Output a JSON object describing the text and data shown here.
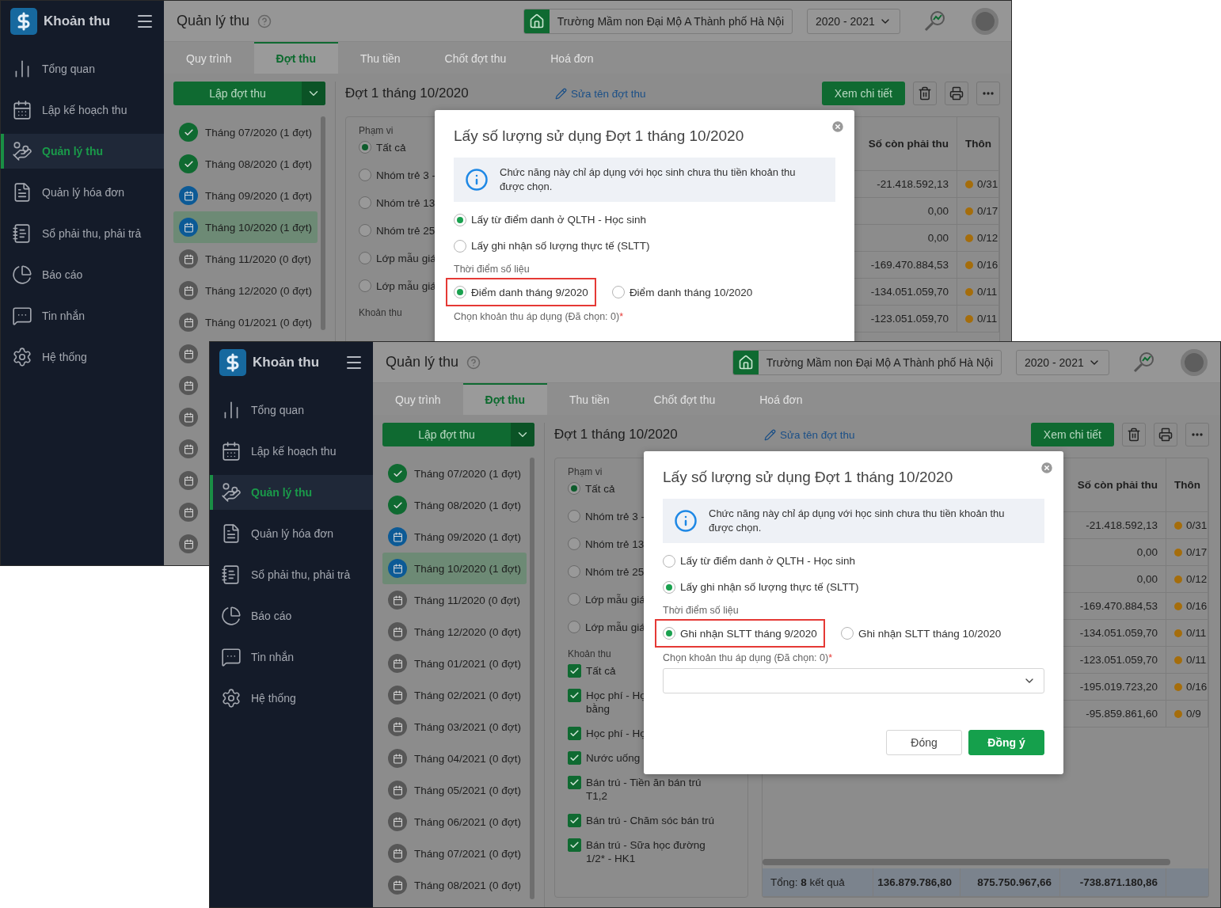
{
  "shots": [
    {
      "sidebar": {
        "title": "Khoản thu",
        "items": [
          {
            "label": "Tổng quan",
            "selected": false
          },
          {
            "label": "Lập kế hoạch thu",
            "selected": false
          },
          {
            "label": "Quản lý thu",
            "selected": true
          },
          {
            "label": "Quản lý hóa đơn",
            "selected": false
          },
          {
            "label": "Sổ phải thu, phải trả",
            "selected": false
          },
          {
            "label": "Báo cáo",
            "selected": false
          },
          {
            "label": "Tin nhắn",
            "selected": false
          },
          {
            "label": "Hệ thống",
            "selected": false
          }
        ]
      },
      "header": {
        "title": "Quản lý thu",
        "school": "Trường Mầm non Đại Mộ A Thành phố Hà Nội",
        "year": "2020 - 2021"
      },
      "tabs": [
        {
          "label": "Quy trình",
          "selected": false
        },
        {
          "label": "Đợt thu",
          "selected": true
        },
        {
          "label": "Thu tiền",
          "selected": false
        },
        {
          "label": "Chốt đợt thu",
          "selected": false
        },
        {
          "label": "Hoá đơn",
          "selected": false
        }
      ],
      "periods": {
        "button": "Lập đợt thu",
        "items": [
          {
            "label": "Tháng 07/2020 (1 đợt)",
            "kind": "done",
            "selected": false
          },
          {
            "label": "Tháng 08/2020 (1 đợt)",
            "kind": "done",
            "selected": false
          },
          {
            "label": "Tháng 09/2020 (1 đợt)",
            "kind": "current",
            "selected": false
          },
          {
            "label": "Tháng 10/2020 (1 đợt)",
            "kind": "current",
            "selected": true
          },
          {
            "label": "Tháng 11/2020 (0 đợt)",
            "kind": "pending",
            "selected": false
          },
          {
            "label": "Tháng 12/2020 (0 đợt)",
            "kind": "pending",
            "selected": false
          },
          {
            "label": "Tháng 01/2021 (0 đợt)",
            "kind": "pending",
            "selected": false
          },
          {
            "kind": "pending",
            "selected": false
          },
          {
            "kind": "pending",
            "selected": false
          },
          {
            "kind": "pending",
            "selected": false
          },
          {
            "kind": "pending",
            "selected": false
          },
          {
            "kind": "pending",
            "selected": false
          },
          {
            "kind": "pending",
            "selected": false
          },
          {
            "kind": "pending",
            "selected": false
          }
        ]
      },
      "batch": {
        "title": "Đợt 1 tháng 10/2020",
        "rename_link": "Sửa tên đợt thu",
        "detail_button": "Xem chi tiết"
      },
      "filters": {
        "scope_label": "Phạm vi",
        "scope": [
          {
            "label": "Tất cả",
            "selected": true
          },
          {
            "label": "Nhóm trẻ 3 -",
            "selected": false
          },
          {
            "label": "Nhóm trẻ 13",
            "selected": false
          },
          {
            "label": "Nhóm trẻ 25",
            "selected": false
          },
          {
            "label": "Lớp mẫu giá",
            "selected": false
          },
          {
            "label": "Lớp mẫu giá",
            "selected": false
          }
        ],
        "fee_label": "Khoản thu"
      },
      "table": {
        "columns": [
          "Số còn phải thu",
          "Thôn"
        ],
        "rows": [
          {
            "amount": "-21.418.592,13",
            "ratio": "0/31"
          },
          {
            "amount": "0,00",
            "ratio": "0/17"
          },
          {
            "amount": "0,00",
            "ratio": "0/12"
          },
          {
            "amount": "-169.470.884,53",
            "ratio": "0/16"
          },
          {
            "amount": "-134.051.059,70",
            "ratio": "0/11"
          },
          {
            "amount": "-123.051.059,70",
            "ratio": "0/11"
          }
        ]
      },
      "dialog": {
        "title": "Lấy số lượng sử dụng Đợt 1 tháng 10/2020",
        "info": "Chức năng này chỉ áp dụng với học sinh chưa thu tiền khoản thu được chọn.",
        "sources": [
          {
            "label": "Lấy từ điểm danh ở QLTH - Học sinh",
            "selected": true
          },
          {
            "label": "Lấy ghi nhận số lượng thực tế (SLTT)",
            "selected": false
          }
        ],
        "time_label": "Thời điểm số liệu",
        "times": [
          {
            "label": "Điểm danh tháng 9/2020",
            "selected": true,
            "highlighted": true
          },
          {
            "label": "Điểm danh tháng 10/2020",
            "selected": false,
            "highlighted": false
          }
        ],
        "items_label": "Chọn khoản thu áp dụng (Đã chọn: 0)",
        "required_mark": "*"
      }
    },
    {
      "sidebar": {
        "title": "Khoản thu",
        "items": [
          {
            "label": "Tổng quan",
            "selected": false
          },
          {
            "label": "Lập kế hoạch thu",
            "selected": false
          },
          {
            "label": "Quản lý thu",
            "selected": true
          },
          {
            "label": "Quản lý hóa đơn",
            "selected": false
          },
          {
            "label": "Sổ phải thu, phải trả",
            "selected": false
          },
          {
            "label": "Báo cáo",
            "selected": false
          },
          {
            "label": "Tin nhắn",
            "selected": false
          },
          {
            "label": "Hệ thống",
            "selected": false
          }
        ]
      },
      "header": {
        "title": "Quản lý thu",
        "school": "Trường Mầm non Đại Mộ A Thành phố Hà Nội",
        "year": "2020 - 2021"
      },
      "tabs": [
        {
          "label": "Quy trình",
          "selected": false
        },
        {
          "label": "Đợt thu",
          "selected": true
        },
        {
          "label": "Thu tiền",
          "selected": false
        },
        {
          "label": "Chốt đợt thu",
          "selected": false
        },
        {
          "label": "Hoá đơn",
          "selected": false
        }
      ],
      "periods": {
        "button": "Lập đợt thu",
        "items": [
          {
            "label": "Tháng 07/2020 (1 đợt)",
            "kind": "done",
            "selected": false
          },
          {
            "label": "Tháng 08/2020 (1 đợt)",
            "kind": "done",
            "selected": false
          },
          {
            "label": "Tháng 09/2020 (1 đợt)",
            "kind": "current",
            "selected": false
          },
          {
            "label": "Tháng 10/2020 (1 đợt)",
            "kind": "current",
            "selected": true
          },
          {
            "label": "Tháng 11/2020 (0 đợt)",
            "kind": "pending",
            "selected": false
          },
          {
            "label": "Tháng 12/2020 (0 đợt)",
            "kind": "pending",
            "selected": false
          },
          {
            "label": "Tháng 01/2021 (0 đợt)",
            "kind": "pending",
            "selected": false
          },
          {
            "label": "Tháng 02/2021 (0 đợt)",
            "kind": "pending",
            "selected": false
          },
          {
            "label": "Tháng 03/2021 (0 đợt)",
            "kind": "pending",
            "selected": false
          },
          {
            "label": "Tháng 04/2021 (0 đợt)",
            "kind": "pending",
            "selected": false
          },
          {
            "label": "Tháng 05/2021 (0 đợt)",
            "kind": "pending",
            "selected": false
          },
          {
            "label": "Tháng 06/2021 (0 đợt)",
            "kind": "pending",
            "selected": false
          },
          {
            "label": "Tháng 07/2021 (0 đợt)",
            "kind": "pending",
            "selected": false
          },
          {
            "label": "Tháng 08/2021 (0 đợt)",
            "kind": "pending",
            "selected": false
          }
        ]
      },
      "batch": {
        "title": "Đợt 1 tháng 10/2020",
        "rename_link": "Sửa tên đợt thu",
        "detail_button": "Xem chi tiết"
      },
      "filters": {
        "scope_label": "Phạm vi",
        "scope": [
          {
            "label": "Tất cả",
            "selected": true
          },
          {
            "label": "Nhóm trẻ 3 -",
            "selected": false
          },
          {
            "label": "Nhóm trẻ 13",
            "selected": false
          },
          {
            "label": "Nhóm trẻ 25",
            "selected": false
          },
          {
            "label": "Lớp mẫu giá",
            "selected": false
          },
          {
            "label": "Lớp mẫu giá",
            "selected": false
          }
        ],
        "fee_label": "Khoản thu",
        "fees": [
          {
            "label": "Tất cả",
            "checked": true
          },
          {
            "label": "Học phí - Họ\nbằng",
            "checked": true
          },
          {
            "label": "Học phí - Họ",
            "checked": true
          },
          {
            "label": "Nước uống",
            "checked": true
          },
          {
            "label": "Bán trú - Tiền ăn bán trú\nT1,2",
            "checked": true
          },
          {
            "label": "Bán trú - Chăm sóc bán trú",
            "checked": true
          },
          {
            "label": "Bán trú - Sữa học đường\n1/2* - HK1",
            "checked": true
          }
        ]
      },
      "table": {
        "columns": [
          "Số còn phải thu",
          "Thôn"
        ],
        "rows": [
          {
            "amount": "-21.418.592,13",
            "ratio": "0/31"
          },
          {
            "amount": "0,00",
            "ratio": "0/17"
          },
          {
            "amount": "0,00",
            "ratio": "0/12"
          },
          {
            "amount": "-169.470.884,53",
            "ratio": "0/16"
          },
          {
            "amount": "-134.051.059,70",
            "ratio": "0/11"
          },
          {
            "amount": "-123.051.059,70",
            "ratio": "0/11"
          },
          {
            "amount": "-195.019.723,20",
            "ratio": "0/16"
          },
          {
            "amount": "-95.859.861,60",
            "ratio": "0/9"
          }
        ],
        "footer": [
          "Tổng: **8** kết quả",
          "136.879.786,80",
          "875.750.967,66",
          "-738.871.180,86"
        ]
      },
      "dialog": {
        "title": "Lấy số lượng sử dụng Đợt 1 tháng 10/2020",
        "info": "Chức năng này chỉ áp dụng với học sinh chưa thu tiền khoản thu được chọn.",
        "sources": [
          {
            "label": "Lấy từ điểm danh ở QLTH - Học sinh",
            "selected": false
          },
          {
            "label": "Lấy ghi nhận số lượng thực tế (SLTT)",
            "selected": true
          }
        ],
        "time_label": "Thời điểm số liệu",
        "times": [
          {
            "label": "Ghi nhận SLTT tháng 9/2020",
            "selected": true,
            "highlighted": true
          },
          {
            "label": "Ghi nhận SLTT tháng 10/2020",
            "selected": false,
            "highlighted": false
          }
        ],
        "items_label": "Chọn khoản thu áp dụng (Đã chọn: 0)",
        "required_mark": "*",
        "item_select": true,
        "buttons": [
          {
            "label": "Đóng",
            "kind": "secondary"
          },
          {
            "label": "Đồng ý",
            "kind": "primary"
          }
        ]
      }
    }
  ]
}
